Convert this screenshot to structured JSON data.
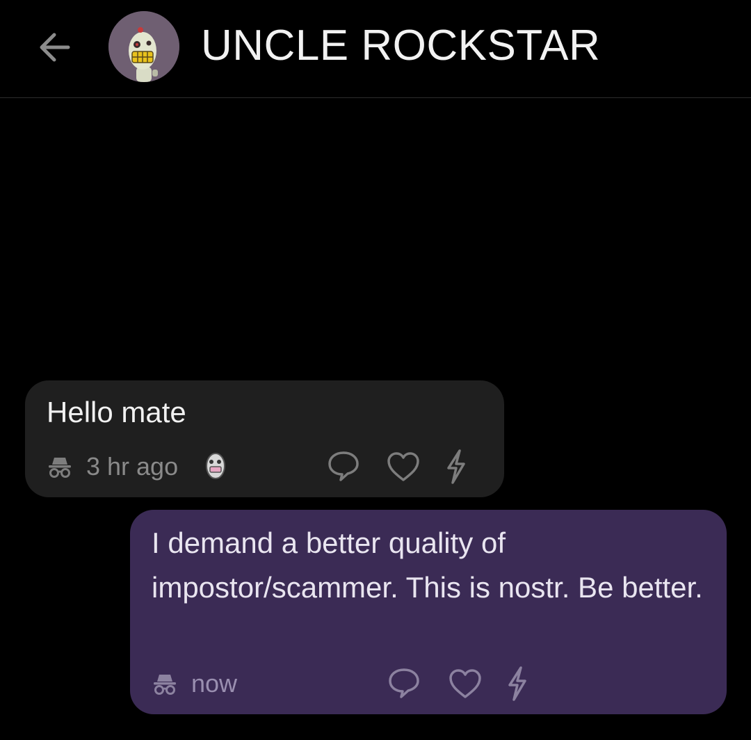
{
  "header": {
    "title": "UNCLE ROCKSTAR",
    "back_icon": "arrow-left-icon",
    "avatar_icon": "robot-avatar"
  },
  "messages": [
    {
      "direction": "incoming",
      "text": "Hello mate",
      "time": "3 hr ago",
      "privacy_icon": "incognito-icon",
      "sender_avatar": "small-avatar",
      "actions": [
        "reply-icon",
        "heart-icon",
        "zap-icon"
      ]
    },
    {
      "direction": "outgoing",
      "text": "I demand a better quality of impostor/scammer. This is nostr. Be better.",
      "time": "now",
      "privacy_icon": "incognito-icon",
      "actions": [
        "reply-icon",
        "heart-icon",
        "zap-icon"
      ]
    }
  ],
  "colors": {
    "background": "#000000",
    "incoming_bubble": "#1f1f1f",
    "outgoing_bubble": "#3b2b55",
    "icon_gray": "#7d7d7d",
    "avatar_bg": "#6f5f72"
  }
}
